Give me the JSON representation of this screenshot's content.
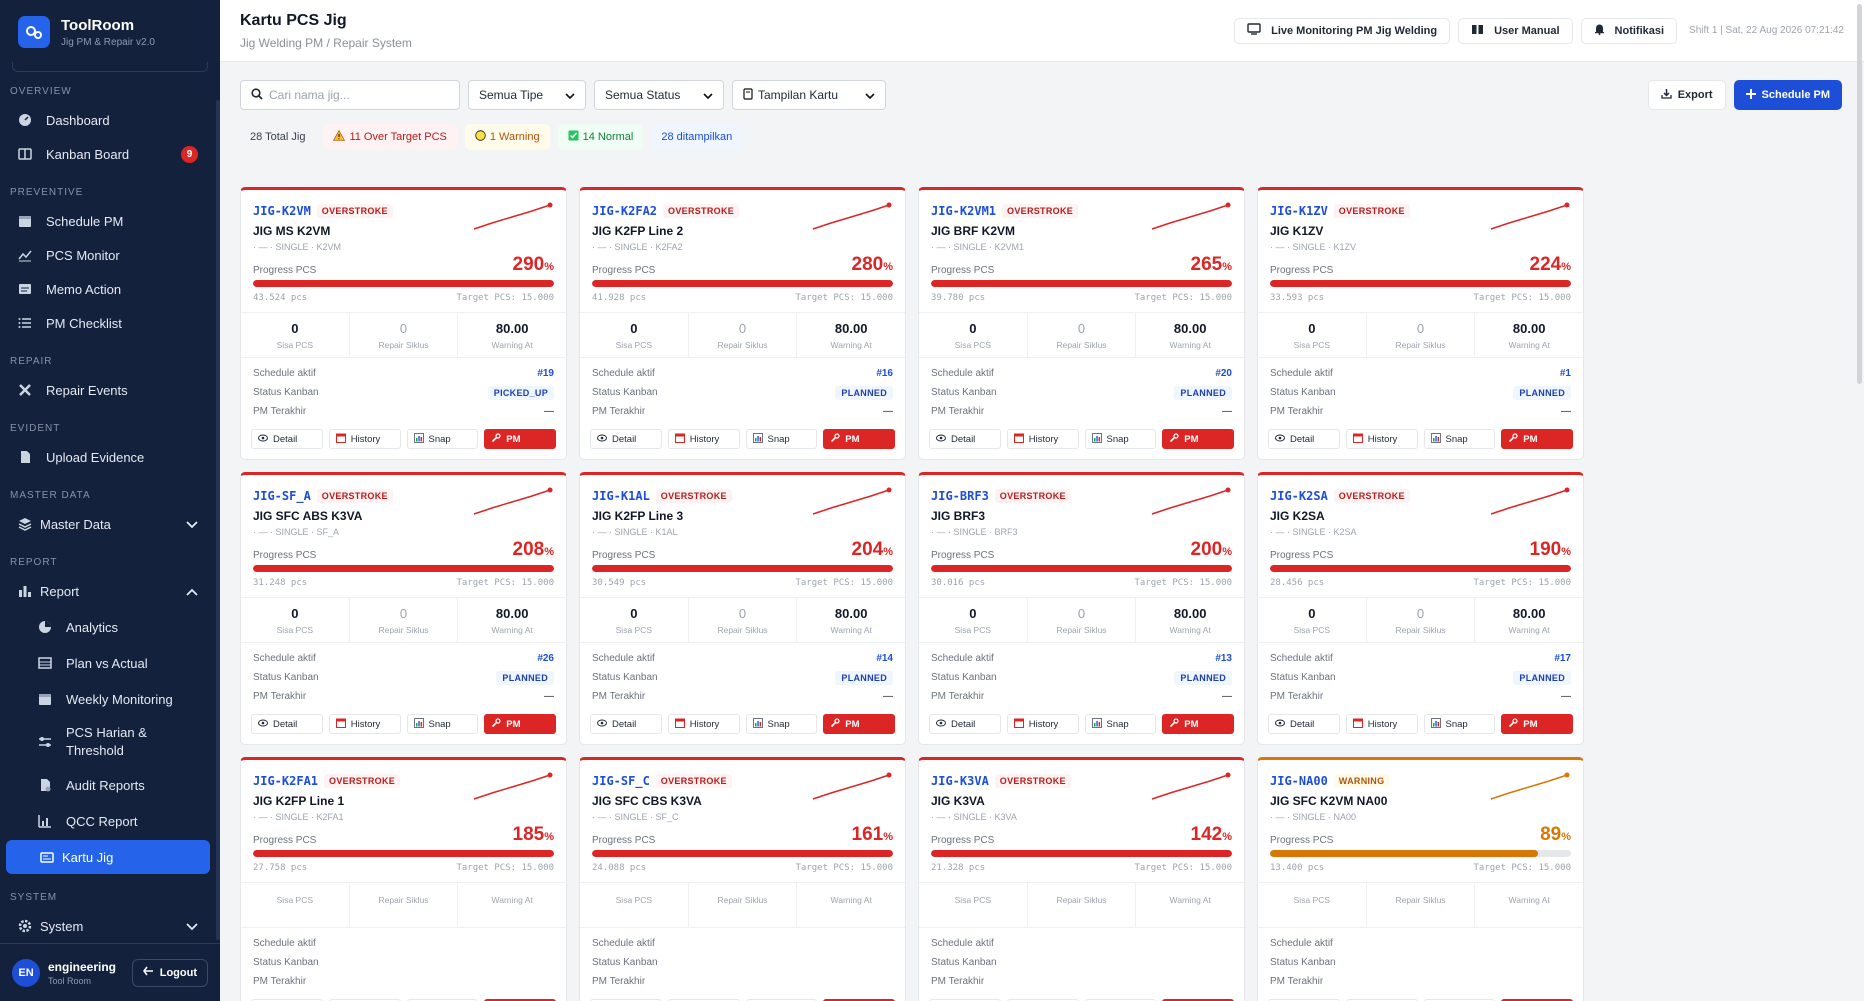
{
  "brand": {
    "title": "ToolRoom",
    "subtitle": "Jig PM & Repair v2.0"
  },
  "nav": {
    "overview_label": "OVERVIEW",
    "dashboard": "Dashboard",
    "kanban": "Kanban Board",
    "kanban_badge": "9",
    "preventive_label": "PREVENTIVE",
    "schedule_pm": "Schedule PM",
    "pcs_monitor": "PCS Monitor",
    "memo_action": "Memo Action",
    "pm_checklist": "PM Checklist",
    "repair_label": "REPAIR",
    "repair_events": "Repair Events",
    "evident_label": "EVIDENT",
    "upload_evidence": "Upload Evidence",
    "masterdata_label": "MASTER DATA",
    "master_data": "Master Data",
    "report_label": "REPORT",
    "report": "Report",
    "analytics": "Analytics",
    "plan_actual": "Plan vs Actual",
    "weekly": "Weekly Monitoring",
    "pcs_harian_1": "PCS Harian &",
    "pcs_harian_2": "Threshold",
    "audit": "Audit Reports",
    "qcc": "QCC Report",
    "kartu_jig": "Kartu Jig",
    "system_label": "SYSTEM",
    "system": "System"
  },
  "user": {
    "initials": "EN",
    "name": "engineering",
    "role": "Tool Room",
    "logout": "Logout"
  },
  "header": {
    "title": "Kartu PCS Jig",
    "subtitle": "Jig Welding PM / Repair System",
    "live_btn": "Live Monitoring PM Jig Welding",
    "manual_btn": "User Manual",
    "notif_btn": "Notifikasi",
    "shift": "Shift 1 | Sat, 22 Aug 2026 07:21:42"
  },
  "filters": {
    "search_placeholder": "Cari nama jig...",
    "type": "Semua Tipe",
    "status": "Semua Status",
    "view": "Tampilan Kartu",
    "export": "Export",
    "schedule": "Schedule PM"
  },
  "stats": {
    "total": "28 Total Jig",
    "over": "11 Over Target PCS",
    "warning": "1 Warning",
    "normal": "14 Normal",
    "shown": "28 ditampilkan"
  },
  "labels": {
    "progress": "Progress PCS",
    "target": "Target PCS: 15.000",
    "sisa": "Sisa PCS",
    "repair": "Repair Siklus",
    "warning_at": "Warning At",
    "schedule": "Schedule aktif",
    "kanban": "Status Kanban",
    "pm_last": "PM Terakhir",
    "detail": "Detail",
    "history": "History",
    "snap": "Snap",
    "pm": "PM"
  },
  "colors": {
    "sidebar": "#14213d",
    "primary": "#1d4ed8",
    "danger": "#dc2626",
    "warning": "#d97706"
  },
  "cards": [
    {
      "code": "JIG-K2VM",
      "tag": "OVERSTROKE",
      "name": "JIG MS K2VM",
      "meta": "· — · SINGLE · K2VM",
      "pct": "290",
      "pct_value": 290,
      "pcs": "43.524 pcs",
      "sisa": "0",
      "repair": "0",
      "warn": "80.00",
      "sched": "#19",
      "status": "PICKED_UP",
      "last": "—",
      "level": "over"
    },
    {
      "code": "JIG-K2FA2",
      "tag": "OVERSTROKE",
      "name": "JIG K2FP Line 2",
      "meta": "· — · SINGLE · K2FA2",
      "pct": "280",
      "pct_value": 280,
      "pcs": "41.928 pcs",
      "sisa": "0",
      "repair": "0",
      "warn": "80.00",
      "sched": "#16",
      "status": "PLANNED",
      "last": "—",
      "level": "over"
    },
    {
      "code": "JIG-K2VM1",
      "tag": "OVERSTROKE",
      "name": "JIG BRF K2VM",
      "meta": "· — · SINGLE · K2VM1",
      "pct": "265",
      "pct_value": 265,
      "pcs": "39.780 pcs",
      "sisa": "0",
      "repair": "0",
      "warn": "80.00",
      "sched": "#20",
      "status": "PLANNED",
      "last": "—",
      "level": "over"
    },
    {
      "code": "JIG-K1ZV",
      "tag": "OVERSTROKE",
      "name": "JIG K1ZV",
      "meta": "· — · SINGLE · K1ZV",
      "pct": "224",
      "pct_value": 224,
      "pcs": "33.593 pcs",
      "sisa": "0",
      "repair": "0",
      "warn": "80.00",
      "sched": "#1",
      "status": "PLANNED",
      "last": "—",
      "level": "over"
    },
    {
      "code": "JIG-SF_A",
      "tag": "OVERSTROKE",
      "name": "JIG SFC ABS K3VA",
      "meta": "· — · SINGLE · SF_A",
      "pct": "208",
      "pct_value": 208,
      "pcs": "31.248 pcs",
      "sisa": "0",
      "repair": "0",
      "warn": "80.00",
      "sched": "#26",
      "status": "PLANNED",
      "last": "—",
      "level": "over"
    },
    {
      "code": "JIG-K1AL",
      "tag": "OVERSTROKE",
      "name": "JIG K2FP Line 3",
      "meta": "· — · SINGLE · K1AL",
      "pct": "204",
      "pct_value": 204,
      "pcs": "30.549 pcs",
      "sisa": "0",
      "repair": "0",
      "warn": "80.00",
      "sched": "#14",
      "status": "PLANNED",
      "last": "—",
      "level": "over"
    },
    {
      "code": "JIG-BRF3",
      "tag": "OVERSTROKE",
      "name": "JIG BRF3",
      "meta": "· — · SINGLE · BRF3",
      "pct": "200",
      "pct_value": 200,
      "pcs": "30.016 pcs",
      "sisa": "0",
      "repair": "0",
      "warn": "80.00",
      "sched": "#13",
      "status": "PLANNED",
      "last": "—",
      "level": "over"
    },
    {
      "code": "JIG-K2SA",
      "tag": "OVERSTROKE",
      "name": "JIG K2SA",
      "meta": "· — · SINGLE · K2SA",
      "pct": "190",
      "pct_value": 190,
      "pcs": "28.456 pcs",
      "sisa": "0",
      "repair": "0",
      "warn": "80.00",
      "sched": "#17",
      "status": "PLANNED",
      "last": "—",
      "level": "over"
    },
    {
      "code": "JIG-K2FA1",
      "tag": "OVERSTROKE",
      "name": "JIG K2FP Line 1",
      "meta": "· — · SINGLE · K2FA1",
      "pct": "185",
      "pct_value": 185,
      "pcs": "27.758 pcs",
      "sisa": "",
      "repair": "",
      "warn": "",
      "sched": "",
      "status": "",
      "last": "",
      "level": "over"
    },
    {
      "code": "JIG-SF_C",
      "tag": "OVERSTROKE",
      "name": "JIG SFC CBS K3VA",
      "meta": "· — · SINGLE · SF_C",
      "pct": "161",
      "pct_value": 161,
      "pcs": "24.088 pcs",
      "sisa": "",
      "repair": "",
      "warn": "",
      "sched": "",
      "status": "",
      "last": "",
      "level": "over"
    },
    {
      "code": "JIG-K3VA",
      "tag": "OVERSTROKE",
      "name": "JIG K3VA",
      "meta": "· — · SINGLE · K3VA",
      "pct": "142",
      "pct_value": 142,
      "pcs": "21.328 pcs",
      "sisa": "",
      "repair": "",
      "warn": "",
      "sched": "",
      "status": "",
      "last": "",
      "level": "over"
    },
    {
      "code": "JIG-NA00",
      "tag": "WARNING",
      "name": "JIG SFC K2VM NA00",
      "meta": "· — · SINGLE · NA00",
      "pct": "89",
      "pct_value": 89,
      "pcs": "13.400 pcs",
      "sisa": "",
      "repair": "",
      "warn": "",
      "sched": "",
      "status": "",
      "last": "",
      "level": "warn"
    }
  ]
}
